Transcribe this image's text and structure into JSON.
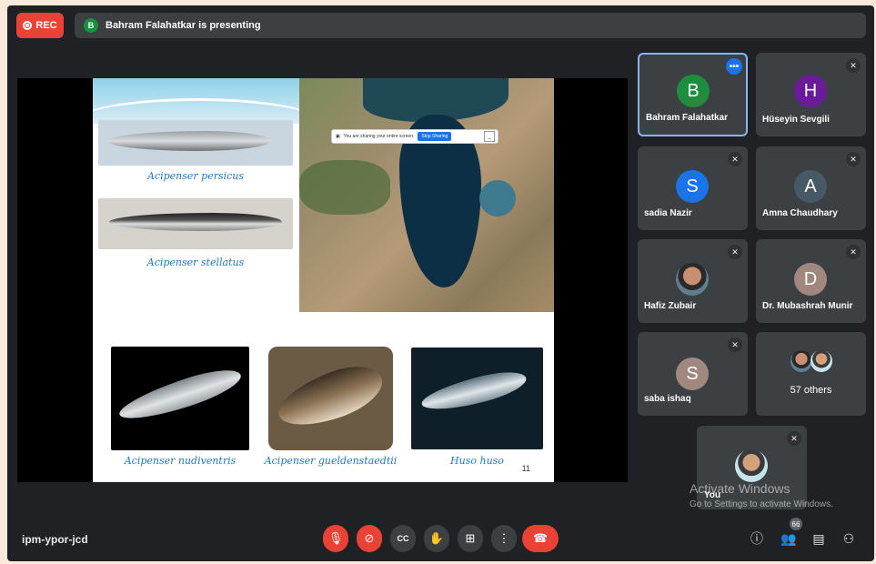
{
  "recording": {
    "label": "REC"
  },
  "presenting": {
    "initial": "B",
    "text": "Bahram Falahatkar is presenting"
  },
  "share_bar": {
    "message": "You are sharing your entire screen.",
    "stop_label": "Stop Sharing",
    "hide_label": "_"
  },
  "slide": {
    "captions": [
      "Acipenser persicus",
      "Acipenser stellatus",
      "Acipenser nudiventris",
      "Acipenser gueldenstaedtii",
      "Huso huso"
    ],
    "page_number": "11"
  },
  "participants": [
    {
      "name": "Bahram Falahatkar",
      "initial": "B",
      "color": "#1e8e3e",
      "muted": false,
      "active": true
    },
    {
      "name": "Hüseyin Sevgili",
      "initial": "H",
      "color": "#6a1b9a",
      "muted": true
    },
    {
      "name": "sadia Nazir",
      "initial": "S",
      "color": "#1a73e8",
      "muted": true
    },
    {
      "name": "Amna Chaudhary",
      "initial": "A",
      "color": "#455a64",
      "muted": true
    },
    {
      "name": "Hafiz Zubair",
      "initial": "",
      "color": "#3c4043",
      "muted": true,
      "photo": true
    },
    {
      "name": "Dr. Mubashrah Munir",
      "initial": "D",
      "color": "#a1887f",
      "muted": true
    },
    {
      "name": "saba ishaq",
      "initial": "S",
      "color": "#a1887f",
      "muted": true
    }
  ],
  "others": {
    "label": "57 others"
  },
  "self_tile": {
    "name": "You",
    "muted": true
  },
  "watermark": {
    "line1": "Activate Windows",
    "line2": "Go to Settings to activate Windows."
  },
  "meeting": {
    "code": "ipm-ypor-jcd"
  },
  "controls": {
    "icons": [
      "mic-off-icon",
      "camera-off-icon",
      "captions-icon",
      "raise-hand-icon",
      "present-icon",
      "more-options-icon",
      "end-call-icon"
    ],
    "mic_glyph": "🎙",
    "cam_glyph": "⊘",
    "cc_glyph": "CC",
    "hand_glyph": "✋",
    "present_glyph": "⊞",
    "more_glyph": "⋮",
    "end_glyph": "☎"
  },
  "right_controls": {
    "info_glyph": "ⓘ",
    "people_glyph": "👥",
    "people_count": "66",
    "chat_glyph": "▤",
    "activities_glyph": "⚇"
  },
  "colors": {
    "background": "#202124",
    "tile": "#3c4043",
    "danger": "#ea4335",
    "accent": "#1a73e8"
  }
}
